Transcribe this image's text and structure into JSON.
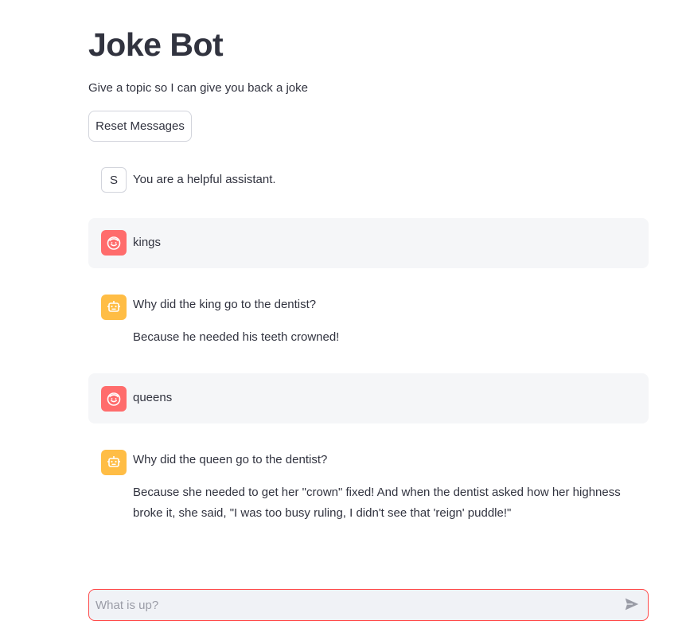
{
  "header": {
    "title": "Joke Bot",
    "subtitle": "Give a topic so I can give you back a joke"
  },
  "reset_button": {
    "label": "Reset Messages"
  },
  "messages": [
    {
      "role": "system",
      "avatar_letter": "S",
      "avatar_icon": "letter",
      "paragraphs": [
        "You are a helpful assistant."
      ]
    },
    {
      "role": "user",
      "avatar_icon": "smiley-face-icon",
      "paragraphs": [
        "kings"
      ]
    },
    {
      "role": "assistant",
      "avatar_icon": "robot-icon",
      "paragraphs": [
        "Why did the king go to the dentist?",
        "Because he needed his teeth crowned!"
      ]
    },
    {
      "role": "user",
      "avatar_icon": "smiley-face-icon",
      "paragraphs": [
        "queens"
      ]
    },
    {
      "role": "assistant",
      "avatar_icon": "robot-icon",
      "paragraphs": [
        "Why did the queen go to the dentist?",
        "Because she needed to get her \"crown\" fixed! And when the dentist asked how her highness broke it, she said, \"I was too busy ruling, I didn't see that 'reign' puddle!\""
      ]
    }
  ],
  "chat_input": {
    "placeholder": "What is up?",
    "value": ""
  },
  "colors": {
    "accent": "#ff4b4b",
    "user_avatar": "#ff6c6c",
    "bot_avatar": "#ffbd45",
    "text": "#31333f",
    "shaded_bg": "#f5f6f8"
  }
}
